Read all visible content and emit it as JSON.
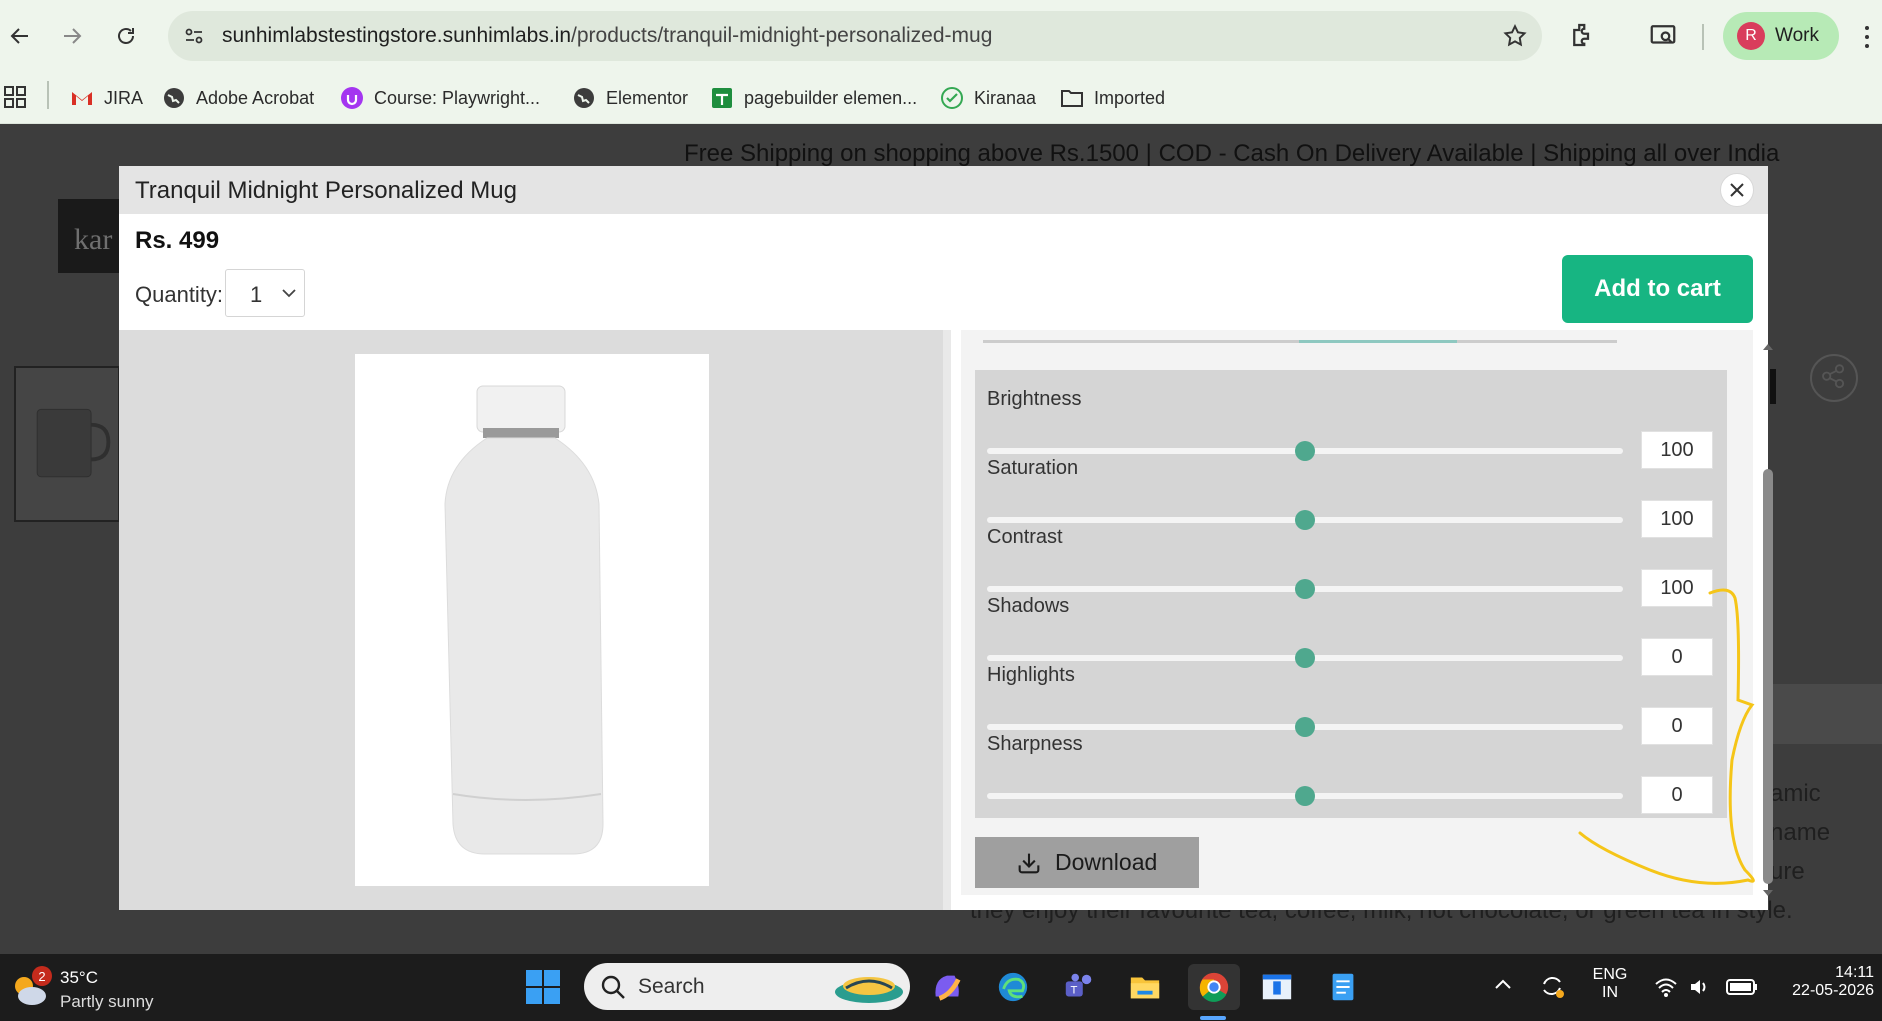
{
  "browser": {
    "url_domain": "sunhimlabstestingstore.sunhimlabs.in",
    "url_path": "/products/tranquil-midnight-personalized-mug",
    "profile_initial": "R",
    "profile_label": "Work"
  },
  "bookmarks": [
    {
      "label": "JIRA",
      "icon": "gmail-icon"
    },
    {
      "label": "Adobe Acrobat",
      "icon": "globe-icon"
    },
    {
      "label": "Course: Playwright...",
      "icon": "course-icon"
    },
    {
      "label": "Elementor",
      "icon": "globe-icon"
    },
    {
      "label": "pagebuilder elemen...",
      "icon": "sheets-icon"
    },
    {
      "label": "Kiranaa",
      "icon": "check-icon"
    },
    {
      "label": "Imported",
      "icon": "folder-icon"
    }
  ],
  "page": {
    "announcement": "Free Shipping on shopping above Rs.1500 | COD - Cash On Delivery Available | Shipping all over India",
    "logo_text": "kar",
    "text_1": "amic",
    "text_2": "name",
    "text_3": "ure",
    "text_4": "they enjoy their favourite tea, coffee, milk, hot chocolate, or green tea in style."
  },
  "modal": {
    "title": "Tranquil Midnight Personalized Mug",
    "price": "Rs. 499",
    "quantity_label": "Quantity:",
    "quantity_value": "1",
    "add_to_cart": "Add to cart",
    "download": "Download",
    "accent_color": "#17b582",
    "slider_color": "#4fa88e"
  },
  "sliders": [
    {
      "label": "Brightness",
      "value": "100",
      "level": 0.5
    },
    {
      "label": "Saturation",
      "value": "100",
      "level": 0.5
    },
    {
      "label": "Contrast",
      "value": "100",
      "level": 0.5
    },
    {
      "label": "Shadows",
      "value": "0",
      "level": 0.5
    },
    {
      "label": "Highlights",
      "value": "0",
      "level": 0.5
    },
    {
      "label": "Sharpness",
      "value": "0",
      "level": 0.5
    }
  ],
  "taskbar": {
    "weather_badge": "2",
    "temperature": "35°C",
    "weather_desc": "Partly sunny",
    "search_placeholder": "Search",
    "lang_1": "ENG",
    "lang_2": "IN",
    "time": "14:11",
    "date": "22-05-2026"
  }
}
